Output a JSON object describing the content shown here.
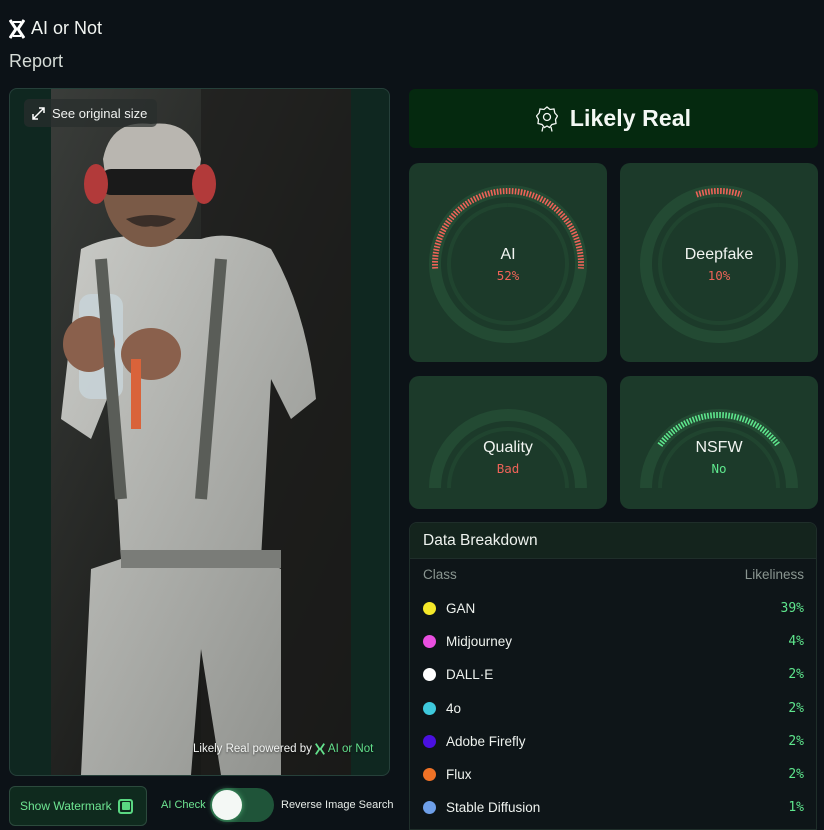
{
  "brand": {
    "name": "AI or Not"
  },
  "page": {
    "title": "Report"
  },
  "image_panel": {
    "see_original_label": "See original size",
    "watermark_text": "Likely Real powered by",
    "watermark_brand": "AI or Not"
  },
  "controls": {
    "show_watermark_label": "Show Watermark",
    "show_watermark_checked": true,
    "ai_check_label": "AI Check",
    "toggle_on": true,
    "reverse_search_label": "Reverse Image Search"
  },
  "verdict": {
    "label": "Likely Real",
    "icon": "award-badge-icon"
  },
  "gauges": [
    {
      "title": "AI",
      "value": "52%",
      "fraction": 0.52,
      "status": "red",
      "color": "#ee6358"
    },
    {
      "title": "Deepfake",
      "value": "10%",
      "fraction": 0.1,
      "status": "red",
      "color": "#ee6358"
    },
    {
      "title": "Quality",
      "value": "Bad",
      "fraction": 0.0,
      "status": "red",
      "color": "#ee6358"
    },
    {
      "title": "NSFW",
      "value": "No",
      "fraction": 0.6,
      "status": "green",
      "color": "#5ee68d"
    }
  ],
  "breakdown": {
    "title": "Data Breakdown",
    "col_class": "Class",
    "col_likeliness": "Likeliness",
    "rows": [
      {
        "name": "GAN",
        "value": "39%",
        "color": "#f5e829"
      },
      {
        "name": "Midjourney",
        "value": "4%",
        "color": "#e94fe0"
      },
      {
        "name": "DALL·E",
        "value": "2%",
        "color": "#ffffff"
      },
      {
        "name": "4o",
        "value": "2%",
        "color": "#3ec9dc"
      },
      {
        "name": "Adobe Firefly",
        "value": "2%",
        "color": "#4a10e0"
      },
      {
        "name": "Flux",
        "value": "2%",
        "color": "#f07226"
      },
      {
        "name": "Stable Diffusion",
        "value": "1%",
        "color": "#6e9fe8"
      }
    ]
  }
}
